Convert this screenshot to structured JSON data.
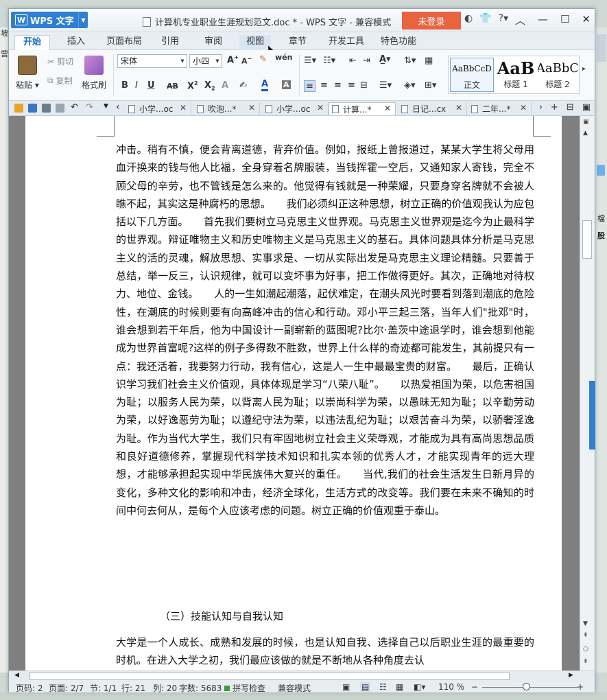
{
  "desktop_left": [
    "坡",
    "营"
  ],
  "desktop_right": [
    "檔",
    "股"
  ],
  "app": {
    "name": "WPS 文字",
    "logo": "W"
  },
  "window": {
    "title": "计算机专业职业生涯规划范文.doc * - WPS 文字 - 兼容模式",
    "login_label": "未登录",
    "ctrl_icons": [
      "dress-icon",
      "shirt-icon",
      "help-icon"
    ]
  },
  "menu": {
    "tabs": [
      "开始",
      "插入",
      "页面布局",
      "引用",
      "审阅",
      "视图",
      "章节",
      "开发工具",
      "特色功能"
    ]
  },
  "ribbon": {
    "paste": "粘贴",
    "cut": "剪切",
    "copy": "复制",
    "format_painter": "格式刷",
    "font_name": "宋体",
    "font_size": "小四",
    "styles": [
      {
        "preview": "AaBbCcD",
        "name": "正文"
      },
      {
        "preview": "AaB",
        "name": "标题 1"
      },
      {
        "preview": "AaBbC",
        "name": "标题 2"
      }
    ]
  },
  "doc_tabs": [
    "小学...oc",
    "吹泡...*",
    "小学...oc",
    "计算...*",
    "日记...cx",
    "二年...*"
  ],
  "document": {
    "paragraph1": "冲击。稍有不慎，便会背离道德，背弃价值。例如，报纸上曾报道过，某某大学生将父母用血汗换来的钱与他人比福，全身穿着名牌服装，当钱挥霍一空后，又通知家人寄钱，完全不顾父母的辛劳，也不管钱是怎么来的。他觉得有钱就是一种荣耀，只要身穿名牌就不会被人瞧不起，其实这是种腐朽的思想。　　我们必须纠正这种思想，树立正确的价值观我认为应包括以下几方面。　　首先我们要树立马克思主义世界观。马克思主义世界观是迄今为止最科学的世界观。辩证唯物主义和历史唯物主义是马克思主义的基石。具体问题具体分析是马克思主义的活的灵魂，解放思想、实事求是、一切从实际出发是马克思主义理论精髓。只要善于总结，举一反三，认识规律，就可以变坏事为好事，把工作做得更好。其次，正确地对待权力、地位、金钱。　　人的一生如潮起潮落，起伏难定，在潮头风光时要看到落到潮底的危险性，在潮底的时候则要有向高峰冲击的信心和行动。邓小平三起三落，当年人们\"批邓\"时，谁会想到若干年后，他为中国设计一副崭新的蓝图呢?比尔·盖茨中途退学时，谁会想到他能成为世界首富呢?这样的例子多得数不胜数，世界上什么样的奇迹都可能发生，其前提只有一点：我还活着，我要努力行动，我有信心，这是人一生中最最宝贵的财富。　　最后，正确认识学习我们社会主义价值观，具体体现是学习“八荣八耻”。　　以热爱祖国为荣，以危害祖国为耻；以服务人民为荣，以背离人民为耻；以崇尚科学为荣，以愚昧无知为耻；以辛勤劳动为荣，以好逸恶劳为耻；以遵纪守法为荣，以违法乱纪为耻；以艰苦奋斗为荣，以骄奢淫逸为耻。作为当代大学生，我们只有牢固地树立社会主义荣辱观，才能成为具有高尚思想品质和良好道德修养，掌握现代科学技术知识和扎实本领的优秀人才，才能实现青年的远大理想，才能够承担起实现中华民族伟大复兴的重任。　　当代,我们的社会生活发生日新月异的变化，多种文化的影响和冲击，经济全球化，生活方式的改变等。我们要在未来不确知的时间中何去何从，是每个人应该考虑的问题。树立正确的价值观重于泰山。",
    "heading": "（三）技能认知与自我认知",
    "paragraph2": "大学是一个人成长、成熟和发展的时候，也是认知自我、选择自己以后职业生涯的最重要的时机。在进入大学之初，我们最应该做的就是不断地从各种角度去认"
  },
  "status": {
    "page": "页码: 2",
    "pages": "页面: 2/7",
    "section": "节: 1/1",
    "row": "行: 21",
    "col": "列: 20",
    "words": "字数: 5683",
    "spell": "拼写检查",
    "compat": "兼容模式",
    "zoom": "110 %",
    "zoom_level_percent": 110
  }
}
